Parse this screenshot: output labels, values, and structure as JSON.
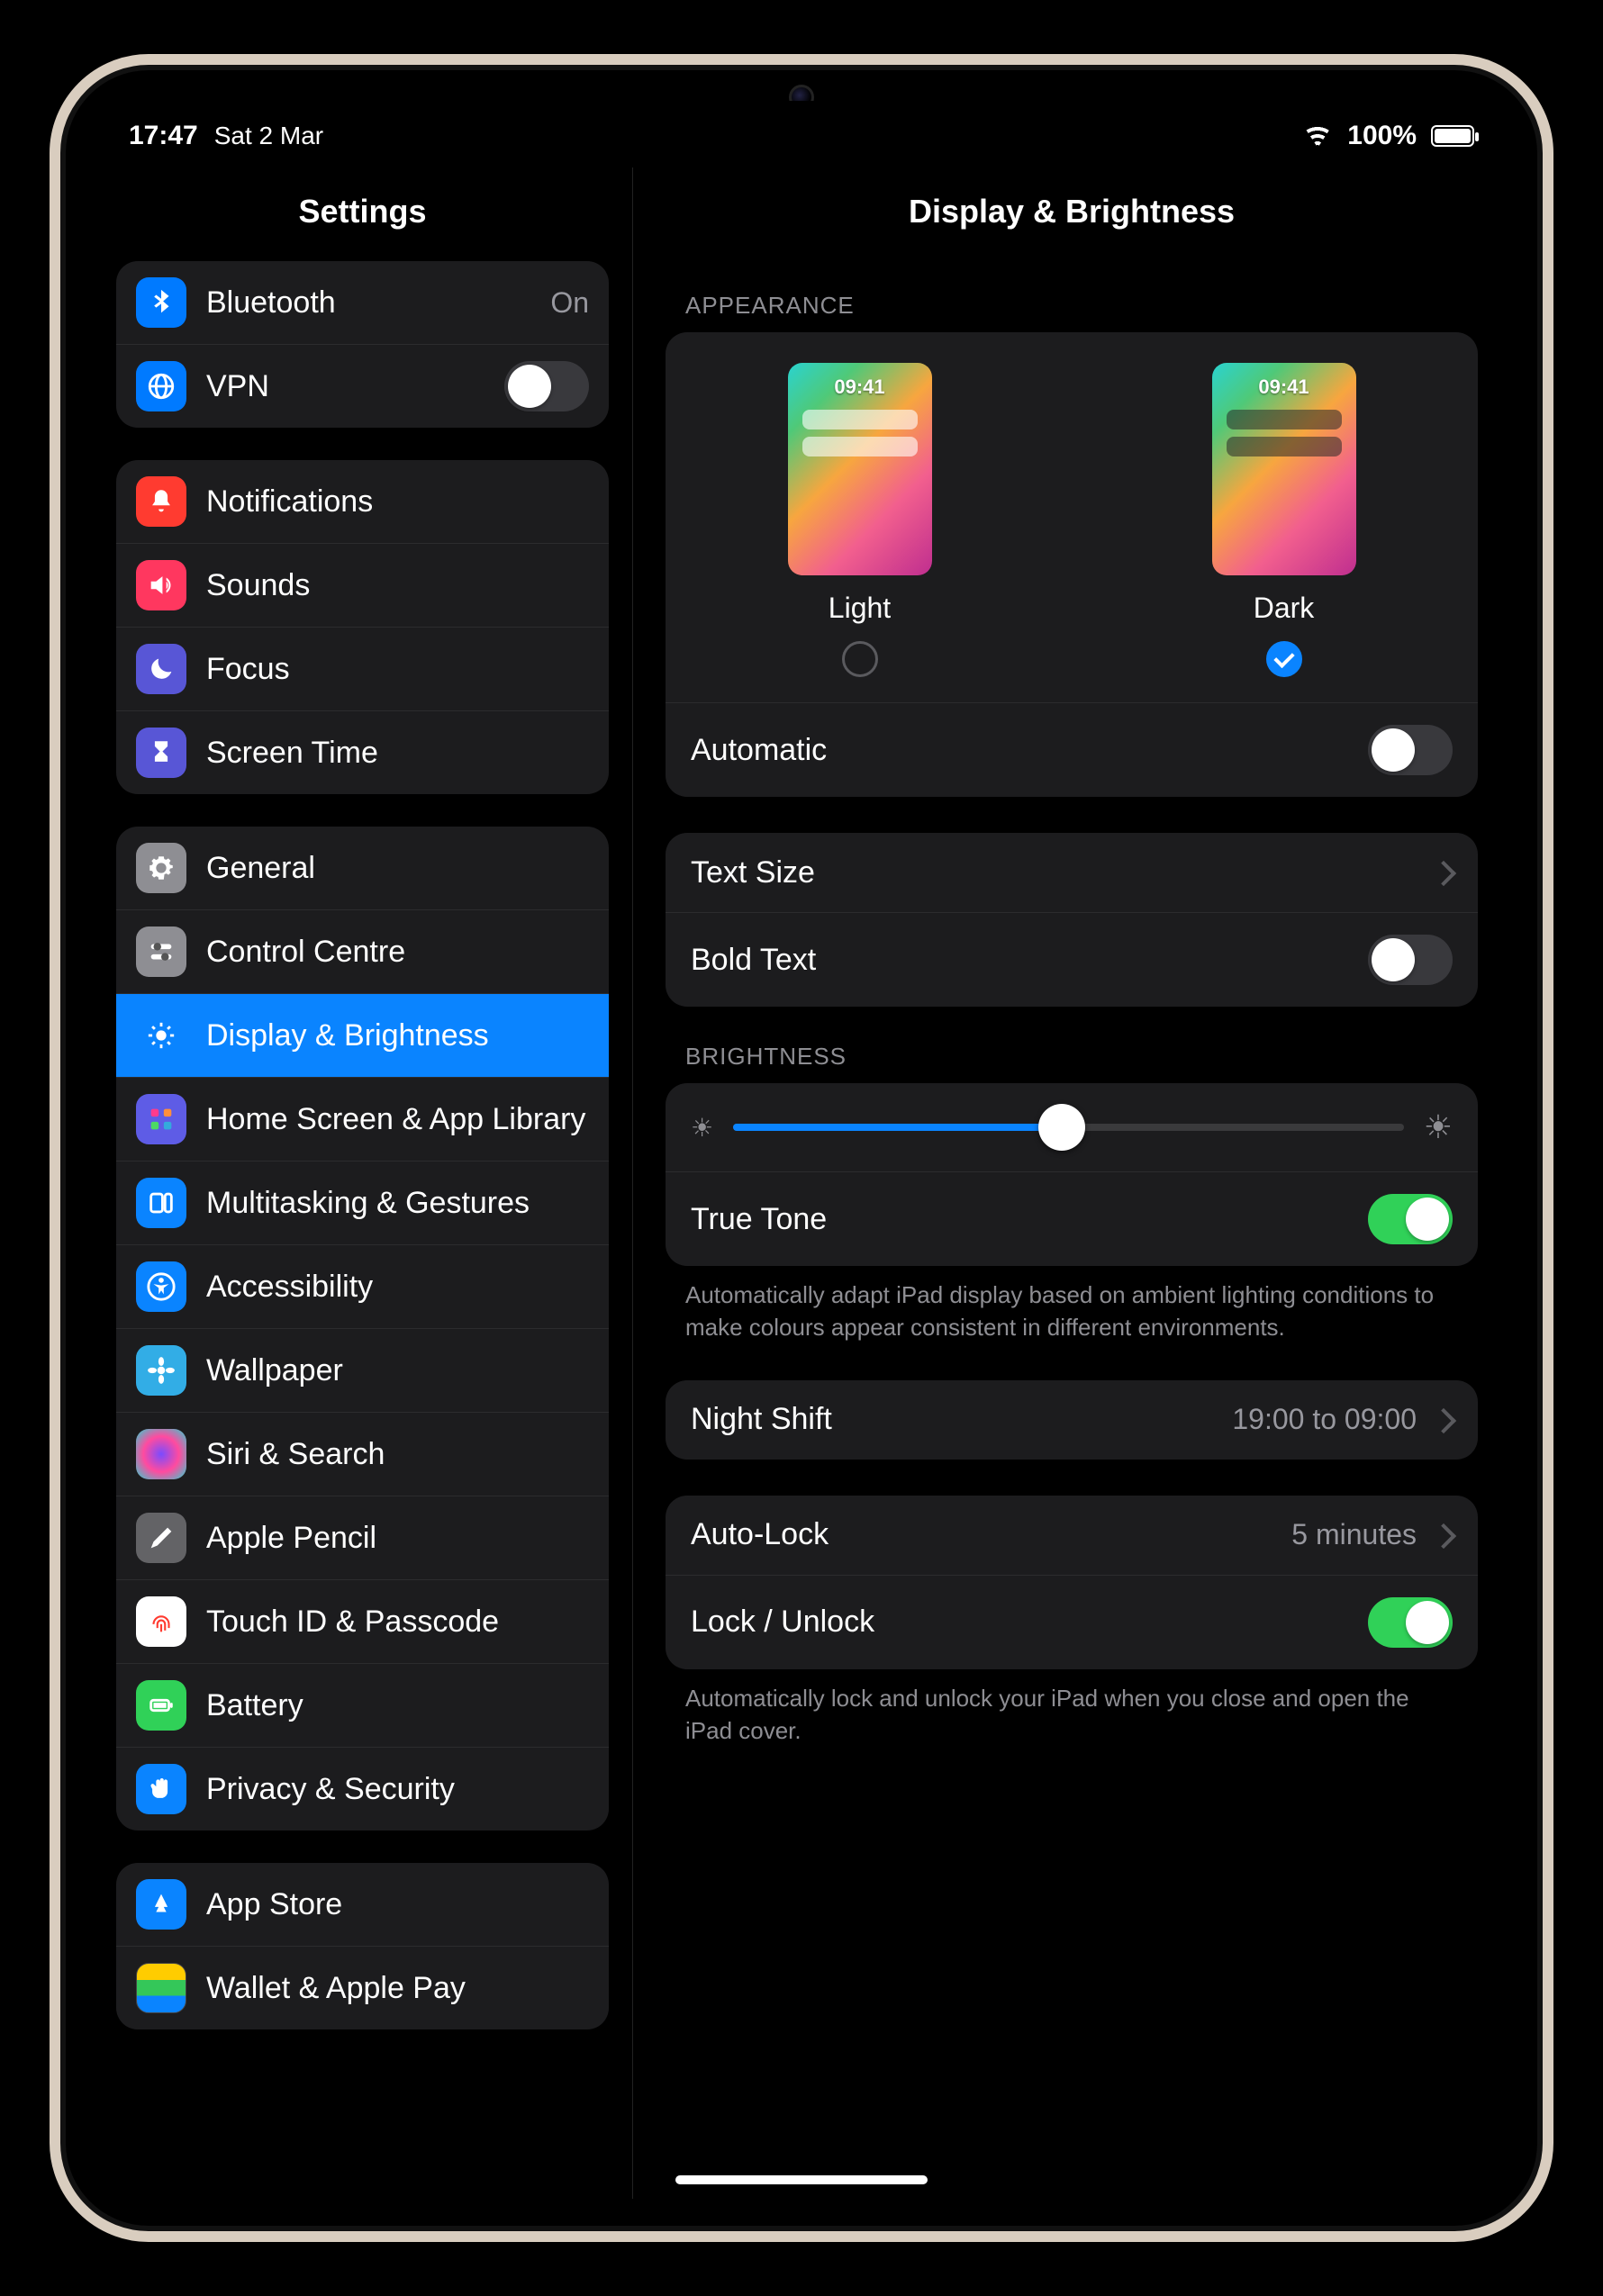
{
  "status": {
    "time": "17:47",
    "date": "Sat 2 Mar",
    "battery": "100%"
  },
  "sidebar": {
    "title": "Settings",
    "group0": {
      "bluetooth": {
        "label": "Bluetooth",
        "value": "On"
      },
      "vpn": {
        "label": "VPN"
      }
    },
    "group1": {
      "notifications": {
        "label": "Notifications"
      },
      "sounds": {
        "label": "Sounds"
      },
      "focus": {
        "label": "Focus"
      },
      "screentime": {
        "label": "Screen Time"
      }
    },
    "group2": {
      "general": {
        "label": "General"
      },
      "controlcentre": {
        "label": "Control Centre"
      },
      "display": {
        "label": "Display & Brightness"
      },
      "homescreen": {
        "label": "Home Screen & App Library"
      },
      "multitasking": {
        "label": "Multitasking & Gestures"
      },
      "accessibility": {
        "label": "Accessibility"
      },
      "wallpaper": {
        "label": "Wallpaper"
      },
      "siri": {
        "label": "Siri & Search"
      },
      "pencil": {
        "label": "Apple Pencil"
      },
      "touchid": {
        "label": "Touch ID & Passcode"
      },
      "battery": {
        "label": "Battery"
      },
      "privacy": {
        "label": "Privacy & Security"
      }
    },
    "group3": {
      "appstore": {
        "label": "App Store"
      },
      "wallet": {
        "label": "Wallet & Apple Pay"
      }
    }
  },
  "main": {
    "title": "Display & Brightness",
    "appearance": {
      "header": "APPEARANCE",
      "preview_time": "09:41",
      "light_label": "Light",
      "dark_label": "Dark",
      "automatic_label": "Automatic"
    },
    "text": {
      "textsize_label": "Text Size",
      "bold_label": "Bold Text"
    },
    "brightness": {
      "header": "BRIGHTNESS",
      "slider_pct": 49,
      "truetone_label": "True Tone",
      "truetone_footer": "Automatically adapt iPad display based on ambient lighting conditions to make colours appear consistent in different environments."
    },
    "nightshift": {
      "label": "Night Shift",
      "value": "19:00 to 09:00"
    },
    "lock": {
      "autolock_label": "Auto-Lock",
      "autolock_value": "5 minutes",
      "lockunlock_label": "Lock / Unlock",
      "footer": "Automatically lock and unlock your iPad when you close and open the iPad cover."
    }
  }
}
